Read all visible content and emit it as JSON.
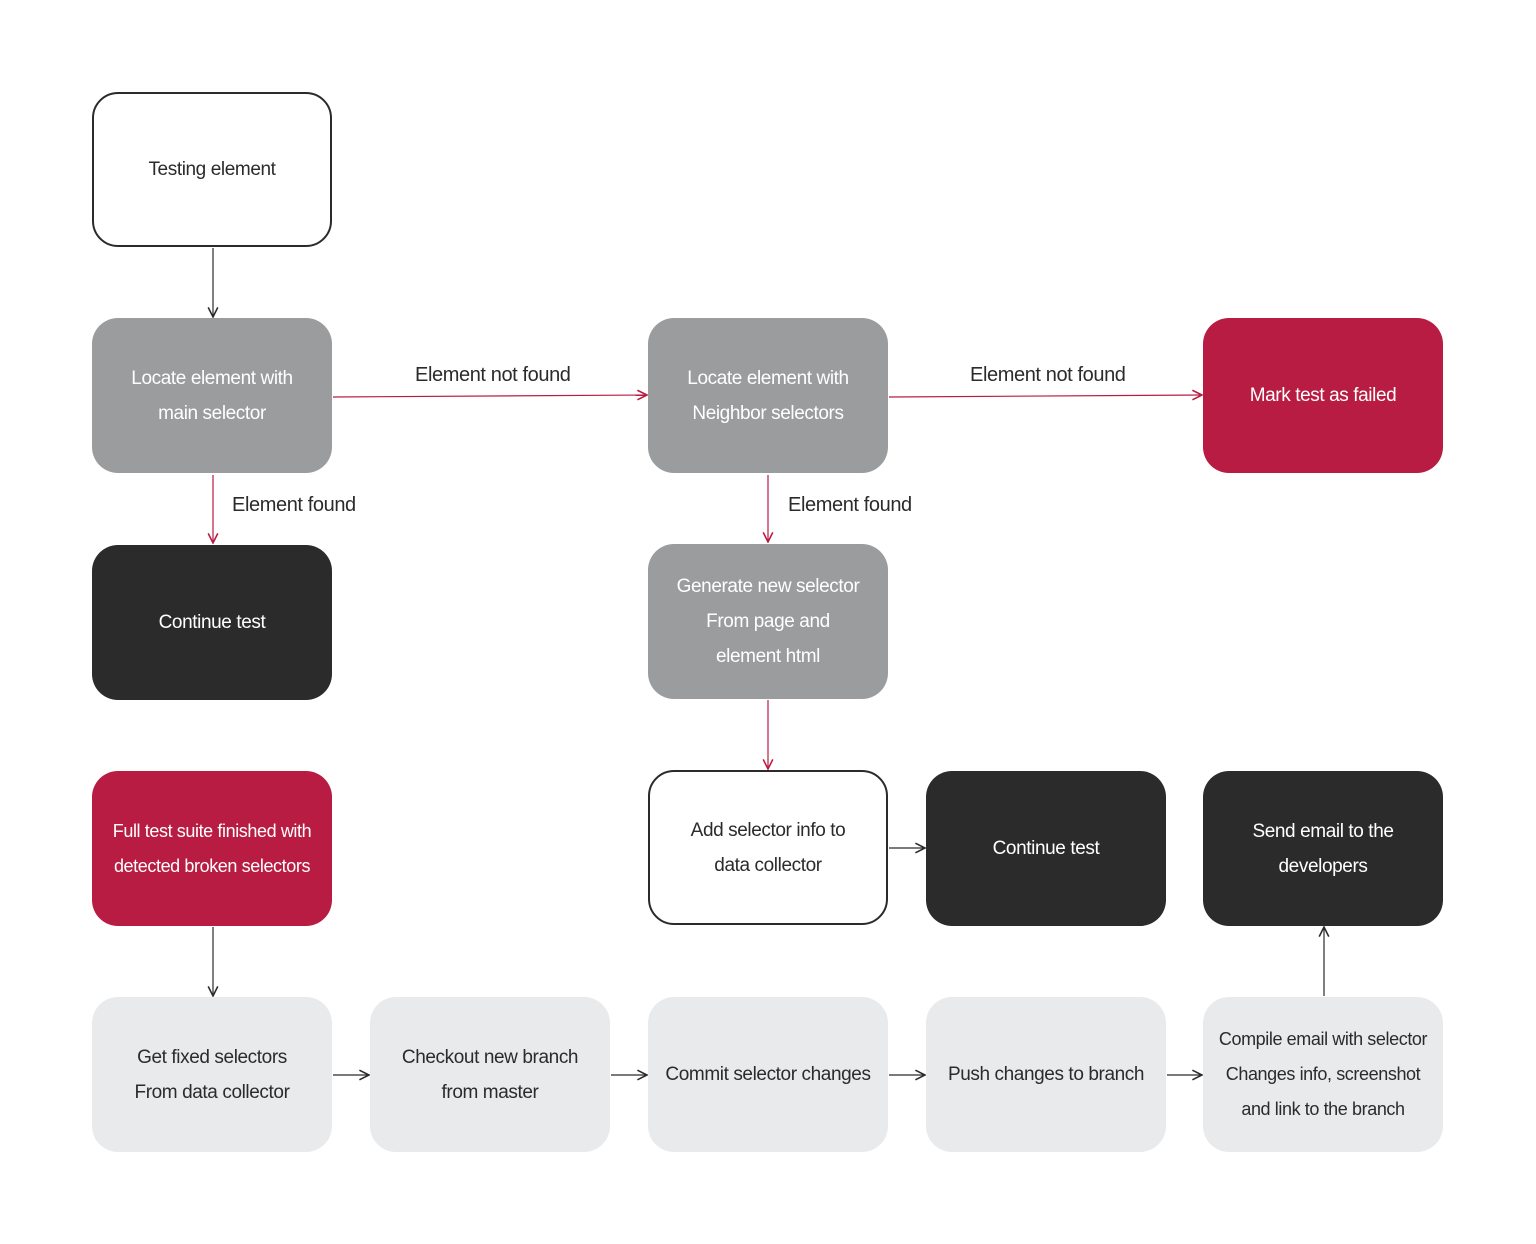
{
  "colors": {
    "gray": "#9b9c9d",
    "red": "#b81c42",
    "dark": "#2b2b2b",
    "light": "#e9eaec",
    "connector_red": "#b81c42",
    "connector_dark": "#2b2b2b"
  },
  "nodes": {
    "testing": "Testing element",
    "locate_main": "Locate element with\nmain selector",
    "locate_neighbor": "Locate element with\nNeighbor selectors",
    "mark_failed": "Mark test as failed",
    "continue1": "Continue test",
    "generate": "Generate new selector\nFrom page and\nelement html",
    "suite_finished": "Full test suite finished with\ndetected broken selectors",
    "add_info": "Add selector info to\ndata collector",
    "continue2": "Continue test",
    "send_email": "Send email to the\ndevelopers",
    "get_fixed": "Get fixed selectors\nFrom data collector",
    "checkout": "Checkout new branch\nfrom master",
    "commit": "Commit selector changes",
    "push": "Push changes to branch",
    "compile": "Compile email with selector\nChanges info, screenshot\nand link to the branch"
  },
  "edge_labels": {
    "not_found_1": "Element not found",
    "not_found_2": "Element not found",
    "found_1": "Element found",
    "found_2": "Element found"
  }
}
